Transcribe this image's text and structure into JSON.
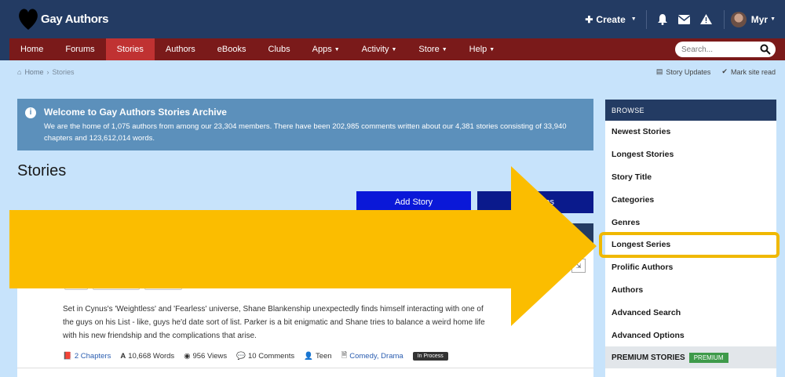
{
  "header": {
    "logo_text": "Gay Authors",
    "create_label": "Create",
    "user_name": "Myr"
  },
  "nav": {
    "items": [
      "Home",
      "Forums",
      "Stories",
      "Authors",
      "eBooks",
      "Clubs",
      "Apps",
      "Activity",
      "Store",
      "Help"
    ],
    "active": "Stories",
    "search_placeholder": "Search..."
  },
  "breadcrumb": {
    "home": "Home",
    "current": "Stories",
    "story_updates": "Story Updates",
    "mark_read": "Mark site read"
  },
  "welcome": {
    "title": "Welcome to Gay Authors Stories Archive",
    "line1": "We are the home of 1,075 authors from among our 23,304 members. There have been 202,985 comments written about our 4,381 stories consisting of 33,940",
    "line2": "chapters and 123,612,014 words."
  },
  "main": {
    "title": "Stories",
    "add_story": "Add Story",
    "second_button": "ies"
  },
  "story": {
    "desc1": "Set in Cynus's 'Weightless' and 'Fearless' universe, Shane Blankenship unexpectedly finds himself interacting with one of",
    "desc2": "the guys on his List - like, guys he'd date sort of list. Parker is a bit enigmatic and Shane tries to balance a weird home life",
    "desc3": "with his new friendship and the complications that arise.",
    "chapters": "2 Chapters",
    "words": "10,668 Words",
    "views": "956 Views",
    "comments": "10 Comments",
    "rating": "Teen",
    "genres": "Comedy, Drama",
    "status": "In Process"
  },
  "browse": {
    "heading": "BROWSE",
    "items": [
      "Newest Stories",
      "Longest Stories",
      "Story Title",
      "Categories",
      "Genres",
      "Longest Series",
      "Prolific Authors",
      "Authors",
      "Advanced Search",
      "Advanced Options"
    ],
    "highlighted": "Longest Series",
    "premium_label": "PREMIUM STORIES",
    "premium_badge": "PREMIUM"
  },
  "colors": {
    "header_bg": "#233b63",
    "nav_bg": "#7a1a1a",
    "nav_active": "#c03232",
    "page_bg": "#c7e3fb",
    "arrow": "#fbbd00",
    "highlight": "#f0b800"
  }
}
